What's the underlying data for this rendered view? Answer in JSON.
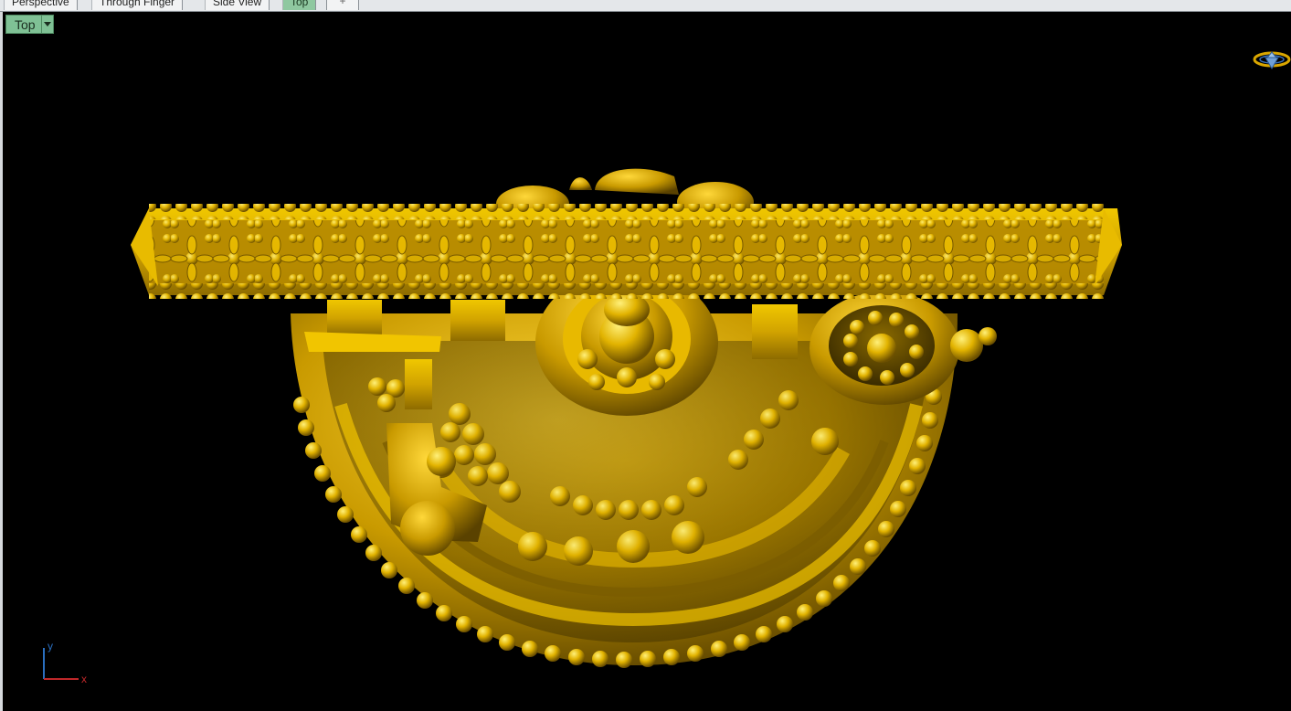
{
  "tabs": [
    {
      "label": "Perspective",
      "active": false
    },
    {
      "label": "Through Finger",
      "active": false
    },
    {
      "label": "Side View",
      "active": false
    },
    {
      "label": "Top",
      "active": true
    }
  ],
  "add_tab_glyph": "+",
  "viewport": {
    "label": "Top",
    "background": "#000000",
    "model_color": "#d7a800",
    "model_icon": "ornate-gold-ring-model"
  },
  "axis": {
    "x_label": "x",
    "y_label": "y",
    "x_color": "#c0282a",
    "y_color": "#2a6fc0"
  },
  "nav_icon": "ring-navigator-icon"
}
